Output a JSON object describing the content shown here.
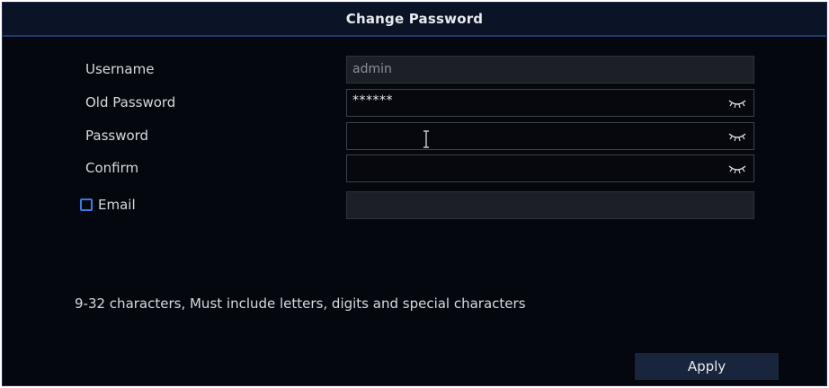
{
  "dialog": {
    "title": "Change Password"
  },
  "form": {
    "username": {
      "label": "Username",
      "value": "admin"
    },
    "old_password": {
      "label": "Old Password",
      "value": "******",
      "toggle_icon": "eye-closed-icon"
    },
    "password": {
      "label": "Password",
      "value": "",
      "toggle_icon": "eye-closed-icon"
    },
    "confirm": {
      "label": "Confirm",
      "value": "",
      "toggle_icon": "eye-closed-icon"
    },
    "email": {
      "label": "Email",
      "checked": false,
      "value": ""
    }
  },
  "hint": "9-32 characters, Must include letters, digits and special characters",
  "actions": {
    "apply_label": "Apply"
  },
  "colors": {
    "background": "#05070e",
    "titlebar": "#0b1426",
    "accent": "#3a7be0",
    "button": "#18253d",
    "text": "#d6d9de"
  }
}
